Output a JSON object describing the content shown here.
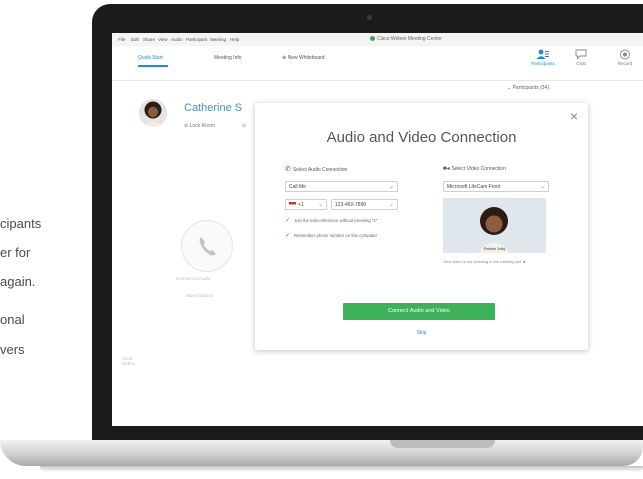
{
  "side_text": [
    "cipants",
    "er for",
    "again.",
    "onal",
    "vers"
  ],
  "window": {
    "title": "Cisco Webex Meeting Center",
    "menu": [
      "File",
      "Edit",
      "Share",
      "View",
      "Audio",
      "Participant",
      "Meeting",
      "Help"
    ]
  },
  "tabs": [
    {
      "label": "Quick Start"
    },
    {
      "label": "Meeting Info"
    },
    {
      "label": "New Whiteboard",
      "icon": "plus-circle"
    }
  ],
  "toolbar": [
    {
      "label": "Participants",
      "icon": "people"
    },
    {
      "label": "Chat",
      "icon": "chat-bubble"
    },
    {
      "label": "Record",
      "icon": "record"
    }
  ],
  "participants_panel": {
    "label": "Participants",
    "count": "(34)"
  },
  "host": {
    "name": "Catherine S",
    "lock_room": "Lock Room"
  },
  "left_pane": {
    "connect_audio": "Connect to Audio",
    "more_options": "More Options",
    "brand": "cisco webex"
  },
  "dialog": {
    "title": "Audio and Video Connection",
    "audio": {
      "section_label": "Select Audio Connection",
      "connection_value": "Call Me",
      "country_code": "+1",
      "phone_number": "123-450-7890",
      "options": [
        {
          "checked": true,
          "label": "Join the teleconference without pressing \"1\""
        },
        {
          "checked": true,
          "label": "Remember phone number on this computer"
        }
      ]
    },
    "video": {
      "section_label": "Select Video Connection",
      "camera_value": "Microsoft LifeCam Front",
      "preview_name": "Patrice Jolly",
      "note": "Your video is not showing in the meeting yet."
    },
    "connect_button": "Connect Audio and Video",
    "skip": "Skip"
  },
  "colors": {
    "accent": "#1f8dd6",
    "connect": "#3db15a",
    "host_name": "#4a90c8"
  }
}
